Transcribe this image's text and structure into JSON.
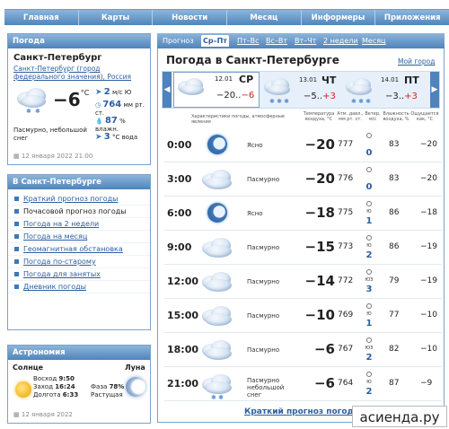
{
  "nav": {
    "items": [
      "Главная",
      "Карты",
      "Новости",
      "Месяц",
      "Информеры",
      "Приложения"
    ]
  },
  "weather_panel": {
    "title": "Погода",
    "city": "Санкт-Петербург",
    "region": "Санкт-Петербург (город федерального значения), Россия",
    "temp": "−6",
    "temp_unit": "°C",
    "wind": "2",
    "wind_unit": "м/с",
    "wind_dir": "Ю",
    "pressure": "764",
    "pressure_unit": "мм рт. ст.",
    "humidity": "87",
    "humidity_unit": "% влажн.",
    "water": "3",
    "water_unit": "°С вода",
    "condition": "Пасмурно, небольшой снег",
    "updated": "12 января 2022 21:00"
  },
  "spb_menu": {
    "title": "В Санкт-Петербурге",
    "items": [
      "Краткий прогноз погоды",
      "Почасовой прогноз погоды",
      "Погода на 2 недели",
      "Погода на месяц",
      "Геомагнитная обстановка",
      "Погода по-старому",
      "Погода для занятых",
      "Дневник погоды"
    ]
  },
  "astro": {
    "title": "Астрономия",
    "sun_label": "Солнце",
    "moon_label": "Луна",
    "sunrise_label": "Восход",
    "sunrise": "9:50",
    "sunset_label": "Заход",
    "sunset": "16:24",
    "daylength_label": "Долгота",
    "daylength": "6:33",
    "phase_label": "Фаза",
    "phase": "78%",
    "phase_state": "Растущая",
    "date": "12 января 2022"
  },
  "tabs": [
    "Прогноз",
    "Ср–Пт",
    "Пт–Вс",
    "Вс–Вт",
    "Вт–Чт",
    "2 недели",
    "Месяц"
  ],
  "header": {
    "title": "Погода в Санкт-Петербурге",
    "my_city": "Мой город"
  },
  "days": [
    {
      "date": "12.01",
      "dow": "СР",
      "min": "−20..",
      "max": "−6"
    },
    {
      "date": "13.01",
      "dow": "ЧТ",
      "min": "−5..",
      "max": "+3"
    },
    {
      "date": "14.01",
      "dow": "ПТ",
      "min": "−3..",
      "max": "+3"
    }
  ],
  "columns": {
    "cond": "Характеристики погоды, атмосферные явления",
    "temp": "Температура воздуха, °C",
    "press": "Атм. давл., мм рт. ст.",
    "wind": "Ветер, м/с",
    "hum": "Влажность воздуха, %",
    "feel": "Ощущается как, °C"
  },
  "rows": [
    {
      "time": "0:00",
      "desc": "Ясно",
      "temp": "−20",
      "press": "777",
      "wind_dir": "",
      "wind": "0",
      "hum": "83",
      "feel": "−20"
    },
    {
      "time": "3:00",
      "desc": "Пасмурно",
      "temp": "−20",
      "press": "776",
      "wind_dir": "",
      "wind": "0",
      "hum": "83",
      "feel": "−20"
    },
    {
      "time": "6:00",
      "desc": "Ясно",
      "temp": "−18",
      "press": "775",
      "wind_dir": "Ю",
      "wind": "1",
      "hum": "86",
      "feel": "−18"
    },
    {
      "time": "9:00",
      "desc": "Пасмурно",
      "temp": "−15",
      "press": "773",
      "wind_dir": "Ю",
      "wind": "2",
      "hum": "86",
      "feel": "−19"
    },
    {
      "time": "12:00",
      "desc": "Пасмурно",
      "temp": "−14",
      "press": "772",
      "wind_dir": "ЮЗ",
      "wind": "3",
      "hum": "79",
      "feel": "−19"
    },
    {
      "time": "15:00",
      "desc": "Пасмурно",
      "temp": "−10",
      "press": "769",
      "wind_dir": "Ю",
      "wind": "1",
      "hum": "77",
      "feel": "−10"
    },
    {
      "time": "18:00",
      "desc": "Пасмурно",
      "temp": "−6",
      "press": "767",
      "wind_dir": "ЮЗ",
      "wind": "2",
      "hum": "82",
      "feel": "−10"
    },
    {
      "time": "21:00",
      "desc": "Пасмурно небольшой снег",
      "temp": "−6",
      "press": "764",
      "wind_dir": "Ю",
      "wind": "2",
      "hum": "87",
      "feel": "−9"
    }
  ],
  "footer_link": "Краткий прогноз погоды",
  "watermark": "асиенда.ру"
}
